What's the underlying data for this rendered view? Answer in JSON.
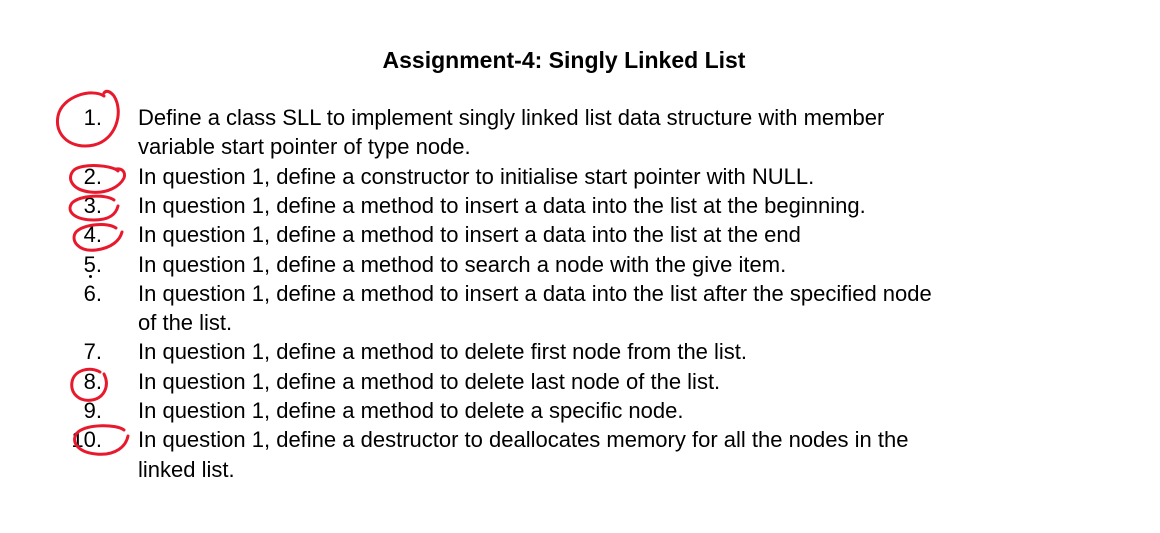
{
  "title": "Assignment-4: Singly Linked List",
  "items": [
    {
      "number": "1.",
      "lines": [
        "Define a class SLL to implement singly linked list data structure with member",
        "variable start pointer of type node."
      ]
    },
    {
      "number": "2.",
      "lines": [
        "In question 1, define a constructor to initialise start pointer with NULL."
      ]
    },
    {
      "number": "3.",
      "lines": [
        "In question 1, define a method to insert a data into the list at the beginning."
      ]
    },
    {
      "number": "4.",
      "lines": [
        "In question 1, define a method to insert a data into the list at the end"
      ]
    },
    {
      "number": "5.",
      "lines": [
        "In question 1, define a method to search a node with the give item."
      ]
    },
    {
      "number": "6.",
      "lines": [
        "In question 1, define a method to insert a data into the list after the specified node",
        "of the list."
      ]
    },
    {
      "number": "7.",
      "lines": [
        "In question 1, define a method to delete first node from the list."
      ]
    },
    {
      "number": "8.",
      "lines": [
        "In question 1, define a method to delete last node of the list."
      ]
    },
    {
      "number": "9.",
      "lines": [
        "In question 1, define a method to delete a specific node."
      ]
    },
    {
      "number": "10.",
      "lines": [
        "In question 1, define a destructor to deallocates memory for all the nodes in the",
        "linked list."
      ]
    }
  ],
  "annotations": {
    "ink_color": "#e8192c",
    "circled_items": [
      "1.",
      "2.",
      "3.",
      "4.",
      "8.",
      "10."
    ]
  }
}
